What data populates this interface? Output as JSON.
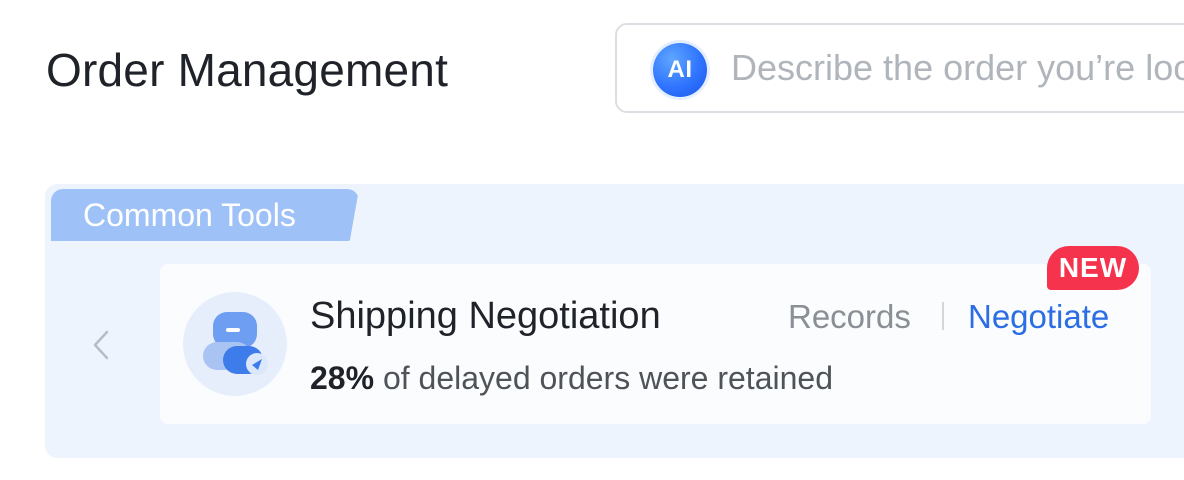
{
  "header": {
    "title": "Order Management"
  },
  "search": {
    "ai_label": "AI",
    "placeholder": "Describe the order you’re looking for"
  },
  "tools_panel": {
    "tab_label": "Common Tools",
    "card": {
      "name": "Shipping Negotiation",
      "desc_highlight": "28%",
      "desc_text": " of delayed orders were retained",
      "records_label": "Records",
      "negotiate_label": "Negotiate",
      "badge": "NEW"
    }
  },
  "colors": {
    "accent": "#2b6de5",
    "badge": "#f5334d",
    "panel_bg": "#eef4fd",
    "tab_bg": "#9ec2f7"
  },
  "icons": {
    "ai": "ai-icon",
    "prev": "chevron-left-icon",
    "tool": "negotiation-icon"
  }
}
